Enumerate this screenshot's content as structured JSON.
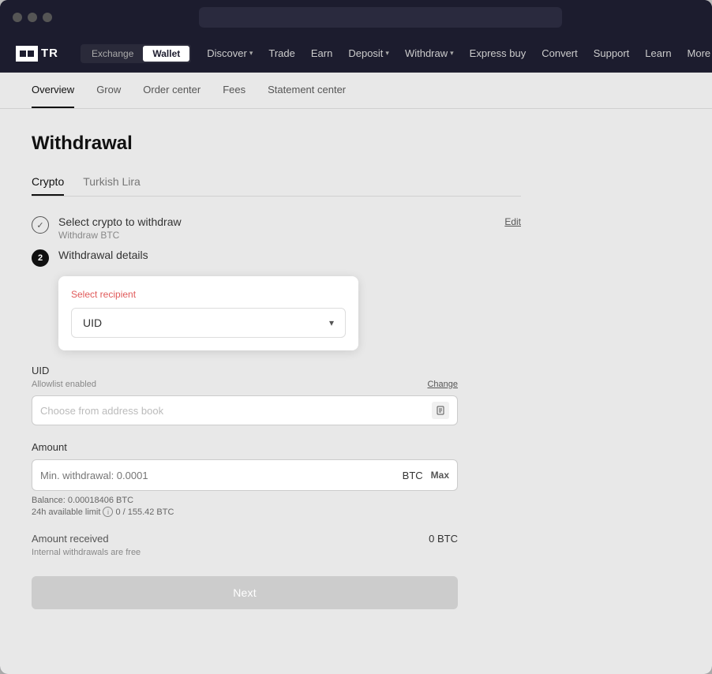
{
  "browser": {
    "traffic_lights": [
      "#ff5f57",
      "#febc2e",
      "#28c840"
    ]
  },
  "nav": {
    "logo_text": "TR",
    "logo_prefix": "OKX",
    "tab_exchange": "Exchange",
    "tab_wallet": "Wallet",
    "items": [
      {
        "label": "Discover",
        "has_chevron": true
      },
      {
        "label": "Trade",
        "has_chevron": false
      },
      {
        "label": "Earn",
        "has_chevron": false
      },
      {
        "label": "Deposit",
        "has_chevron": true
      },
      {
        "label": "Withdraw",
        "has_chevron": true
      },
      {
        "label": "Express buy",
        "has_chevron": false
      },
      {
        "label": "Convert",
        "has_chevron": false
      },
      {
        "label": "Support",
        "has_chevron": false
      },
      {
        "label": "Learn",
        "has_chevron": false
      },
      {
        "label": "More",
        "has_chevron": true
      }
    ]
  },
  "sub_nav": {
    "items": [
      {
        "label": "Overview",
        "active": true
      },
      {
        "label": "Grow",
        "active": false
      },
      {
        "label": "Order center",
        "active": false
      },
      {
        "label": "Fees",
        "active": false
      },
      {
        "label": "Statement center",
        "active": false
      }
    ]
  },
  "page": {
    "title": "Withdrawal",
    "crypto_tabs": [
      {
        "label": "Crypto",
        "active": true
      },
      {
        "label": "Turkish Lira",
        "active": false
      }
    ]
  },
  "steps": {
    "step1": {
      "title": "Select crypto to withdraw",
      "edit_label": "Edit",
      "subtitle": "Withdraw BTC",
      "completed": true
    },
    "step2": {
      "number": "2",
      "title": "Withdrawal details",
      "active": true
    }
  },
  "recipient_dropdown": {
    "label": "Select recipient",
    "selected": "UID"
  },
  "uid_section": {
    "label": "UID",
    "allowlist_text": "Allowlist enabled",
    "change_label": "Change",
    "placeholder": "Choose from address book"
  },
  "amount_section": {
    "label": "Amount",
    "placeholder": "Min. withdrawal: 0.0001",
    "currency": "BTC",
    "max_label": "Max",
    "balance_text": "Balance: 0.00018406 BTC",
    "limit_text": "24h available limit",
    "limit_value": "0 / 155.42 BTC"
  },
  "amount_received": {
    "label": "Amount received",
    "value": "0 BTC",
    "free_note": "Internal withdrawals are free"
  },
  "next_button": {
    "label": "Next"
  }
}
